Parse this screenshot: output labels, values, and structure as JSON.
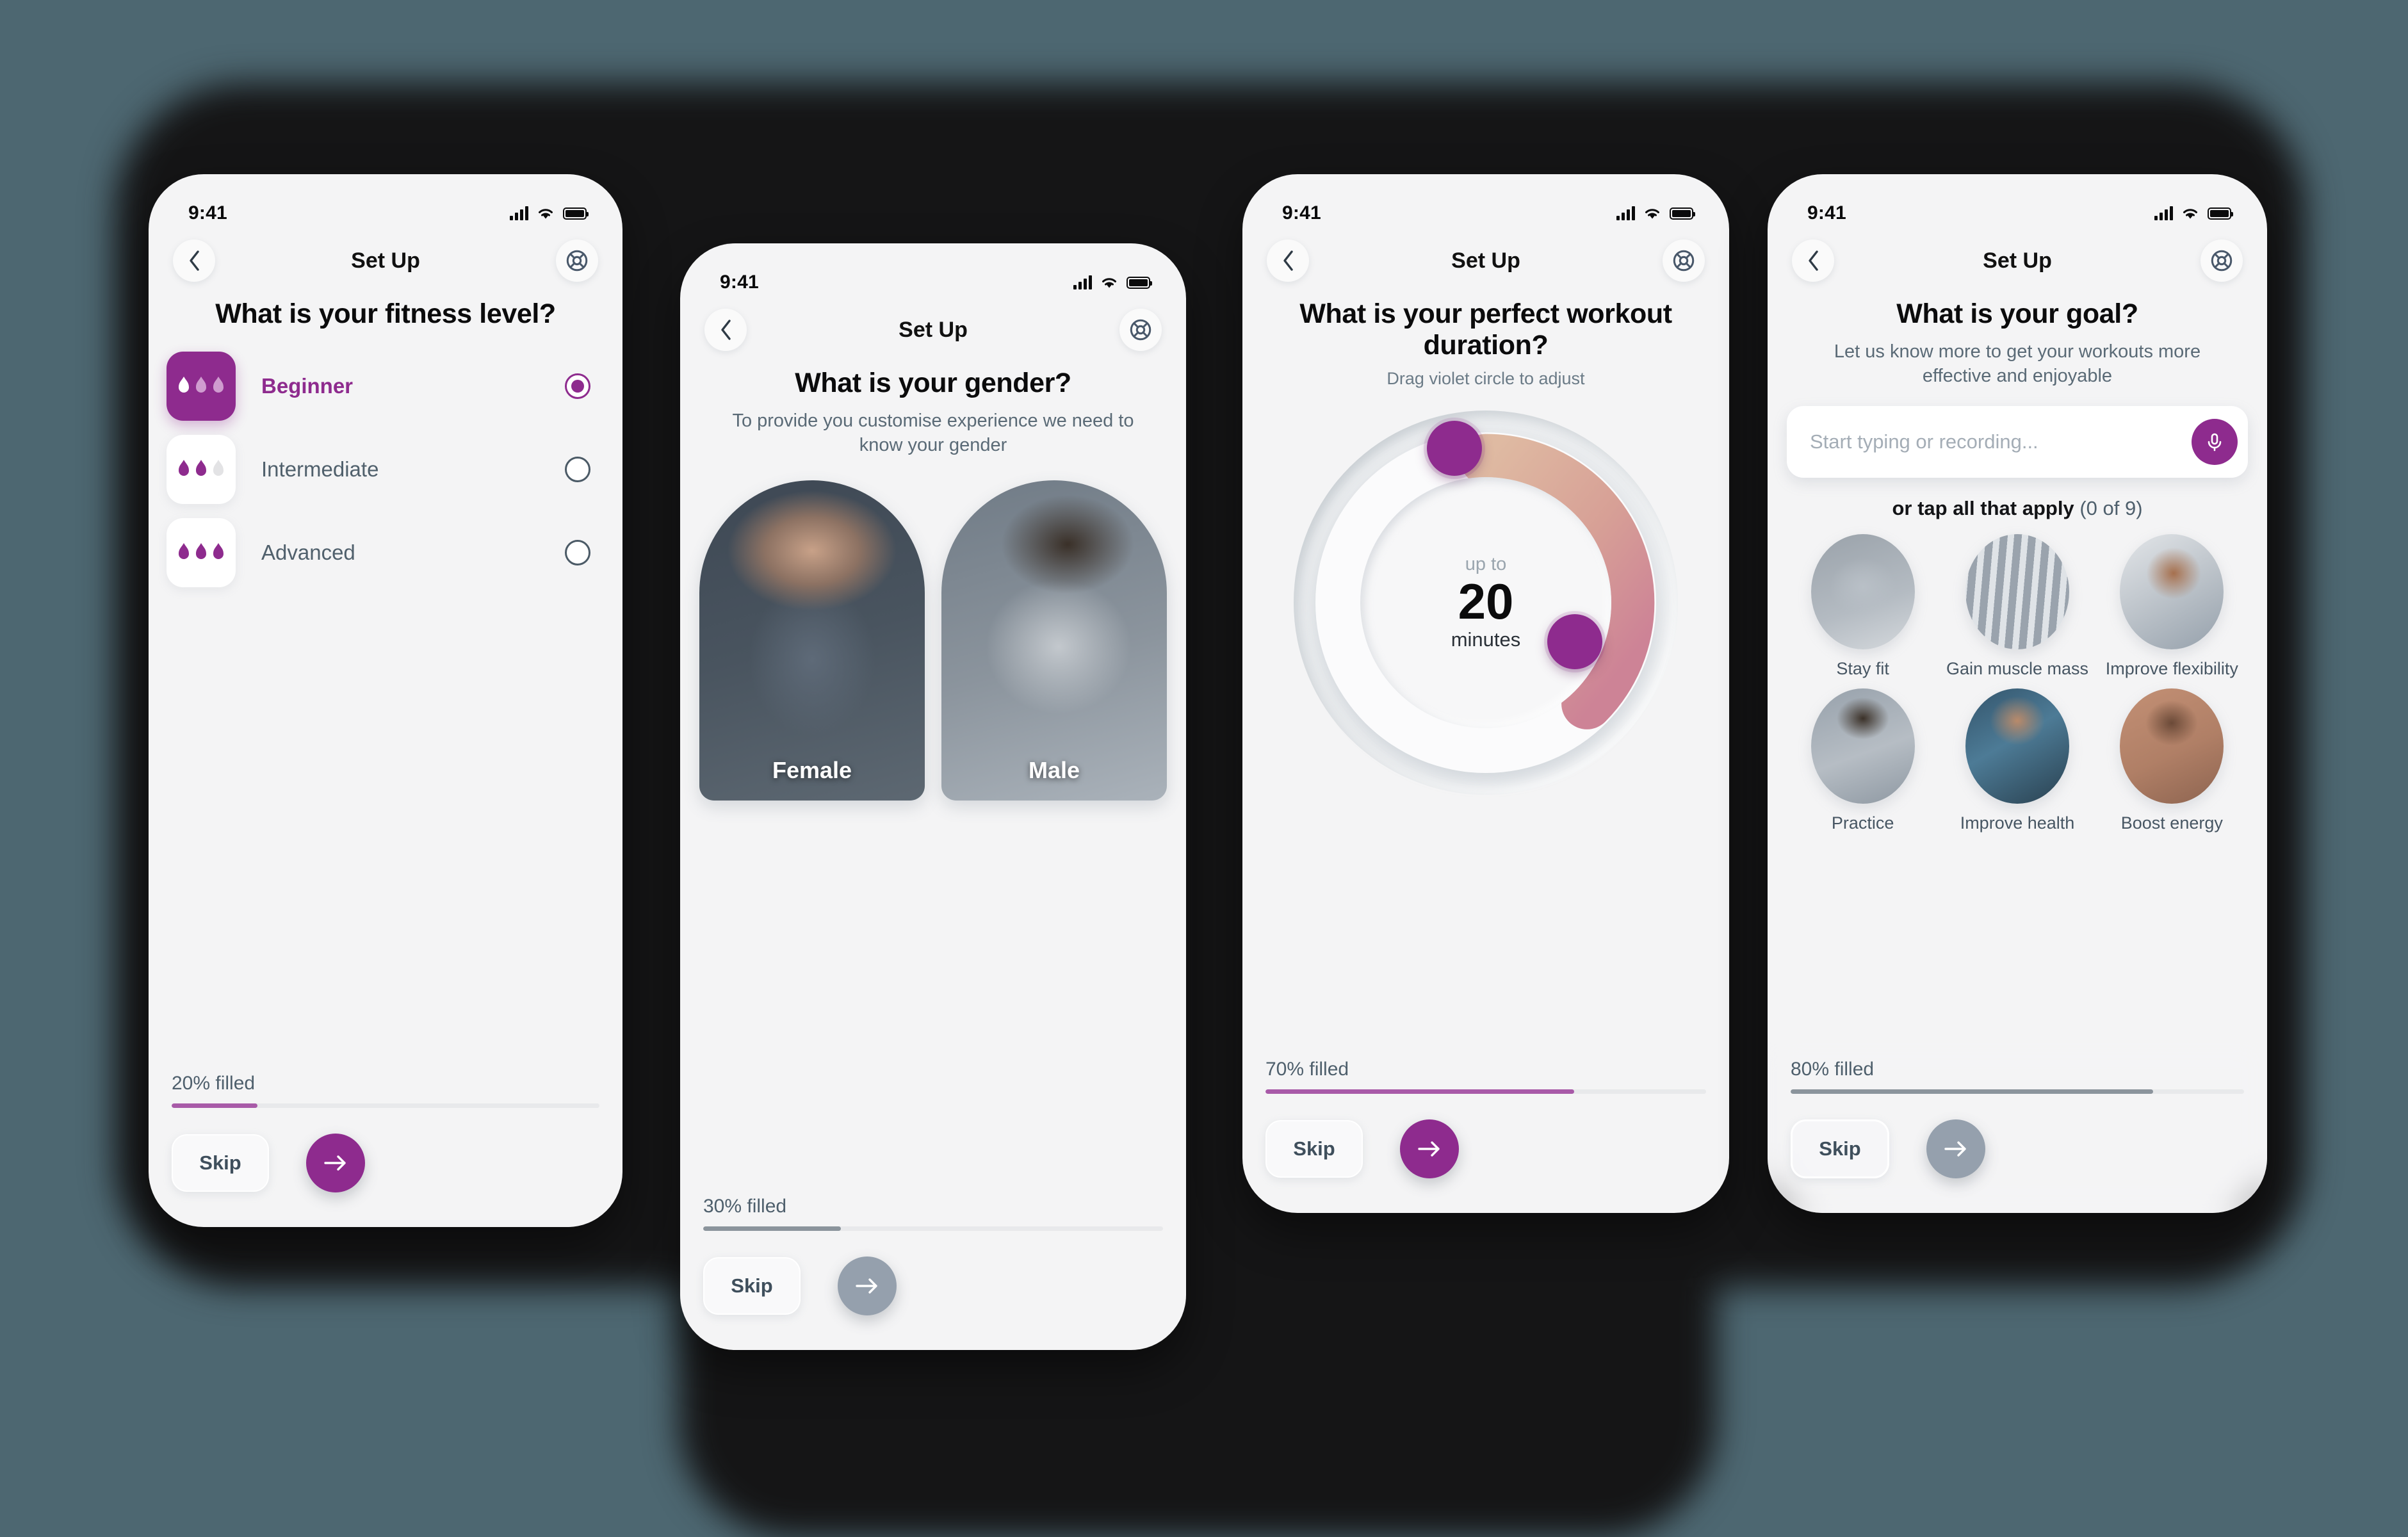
{
  "theme": {
    "background": "#4d6771",
    "blob": "#151516",
    "accent_purple": "#8e2b8e",
    "muted_slate": "#95a0ad",
    "screen_bg": "#f4f4f5"
  },
  "common": {
    "status_time": "9:41",
    "nav_title": "Set Up",
    "back_icon": "chevron-left-icon",
    "help_icon": "life-buoy-icon",
    "skip_label": "Skip",
    "next_icon": "arrow-right-icon",
    "signal_icon": "cellular-signal-icon",
    "wifi_icon": "wifi-icon",
    "battery_icon": "battery-icon"
  },
  "screens": [
    {
      "id": "fitness-level",
      "title": "What is your fitness level?",
      "options": [
        {
          "label": "Beginner",
          "flames_lit": 1,
          "selected": true
        },
        {
          "label": "Intermediate",
          "flames_lit": 2,
          "selected": false
        },
        {
          "label": "Advanced",
          "flames_lit": 3,
          "selected": false
        }
      ],
      "progress_label": "20% filled",
      "progress_value": 20,
      "progress_color": "#a85aa8",
      "next_enabled": true
    },
    {
      "id": "gender",
      "title": "What is your gender?",
      "subtitle": "To provide you customise experience we need to know your gender",
      "choices": [
        {
          "label": "Female",
          "photo": "female"
        },
        {
          "label": "Male",
          "photo": "male"
        }
      ],
      "progress_label": "30% filled",
      "progress_value": 30,
      "progress_color": "#8b949c",
      "next_enabled": false
    },
    {
      "id": "duration",
      "title": "What is your perfect workout duration?",
      "subtitle": "Drag violet circle to adjust",
      "dial": {
        "prefix": "up to",
        "value": "20",
        "unit": "minutes",
        "start_knob_angle_deg": 335,
        "end_knob_angle_deg": 125,
        "arc_gradient_from": "#dcb49c",
        "arc_gradient_to": "#cf8897"
      },
      "progress_label": "70% filled",
      "progress_value": 70,
      "progress_color": "#a85aa8",
      "next_enabled": true
    },
    {
      "id": "goal",
      "title": "What is your goal?",
      "subtitle": "Let us know more to get your workouts more effective and enjoyable",
      "search": {
        "placeholder": "Start typing or recording...",
        "value": "",
        "mic_icon": "microphone-icon"
      },
      "tap_hint": "or tap all that apply",
      "tap_count": "(0 of 9)",
      "goals": [
        {
          "label": "Stay fit",
          "photo": "g1"
        },
        {
          "label": "Gain muscle mass",
          "photo": "g2"
        },
        {
          "label": "Improve flexibility",
          "photo": "g3"
        },
        {
          "label": "Practice",
          "photo": "g4"
        },
        {
          "label": "Improve health",
          "photo": "g5"
        },
        {
          "label": "Boost energy",
          "photo": "g6"
        }
      ],
      "progress_label": "80% filled",
      "progress_value": 80,
      "progress_color": "#8b949c",
      "next_enabled": false
    }
  ]
}
